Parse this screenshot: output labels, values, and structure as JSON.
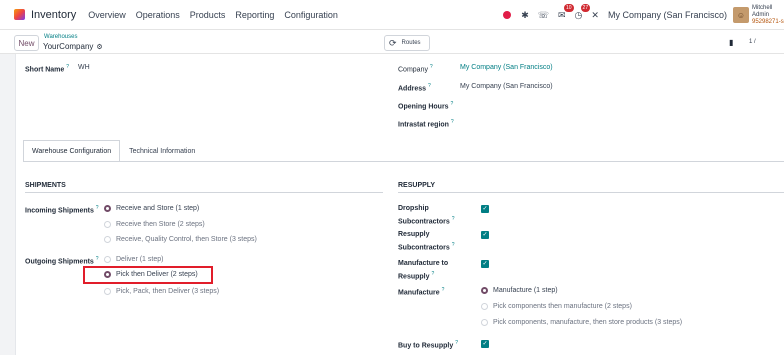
{
  "topbar": {
    "app_name": "Inventory",
    "menu": [
      "Overview",
      "Operations",
      "Products",
      "Reporting",
      "Configuration"
    ],
    "badge_chat": "10",
    "badge_activity": "27",
    "company": "My Company (San Francisco)",
    "user_name": "Mitchell Admin",
    "user_db": "95298271-s"
  },
  "controlbar": {
    "new_label": "New",
    "breadcrumb_parent": "Warehouses",
    "breadcrumb_current": "YourCompany",
    "routes_label": "Routes",
    "pager": "1 /"
  },
  "form": {
    "short_name_label": "Short Name",
    "short_name_value": "WH",
    "company_label": "Company",
    "company_value": "My Company (San Francisco)",
    "address_label": "Address",
    "address_value": "My Company (San Francisco)",
    "opening_hours_label": "Opening Hours",
    "intrastat_label": "Intrastat region"
  },
  "tabs": [
    "Warehouse Configuration",
    "Technical Information"
  ],
  "shipments": {
    "title": "SHIPMENTS",
    "incoming_label": "Incoming Shipments",
    "incoming_options": [
      "Receive and Store (1 step)",
      "Receive then Store (2 steps)",
      "Receive, Quality Control, then Store (3 steps)"
    ],
    "incoming_selected": 0,
    "outgoing_label": "Outgoing Shipments",
    "outgoing_options": [
      "Deliver (1 step)",
      "Pick then Deliver (2 steps)",
      "Pick, Pack, then Deliver (3 steps)"
    ],
    "outgoing_selected": 1
  },
  "resupply": {
    "title": "RESUPPLY",
    "dropship_label_1": "Dropship",
    "dropship_label_2": "Subcontractors",
    "resupply_sub_label_1": "Resupply",
    "resupply_sub_label_2": "Subcontractors",
    "manufacture_resupply_label_1": "Manufacture to",
    "manufacture_resupply_label_2": "Resupply",
    "manufacture_label": "Manufacture",
    "manufacture_options": [
      "Manufacture (1 step)",
      "Pick components then manufacture (2 steps)",
      "Pick components, manufacture, then store products (3 steps)"
    ],
    "manufacture_selected": 0,
    "buy_label": "Buy to Resupply"
  },
  "colors": {
    "accent": "#017e84",
    "brand": "#714b67",
    "highlight": "#e11d2a"
  }
}
